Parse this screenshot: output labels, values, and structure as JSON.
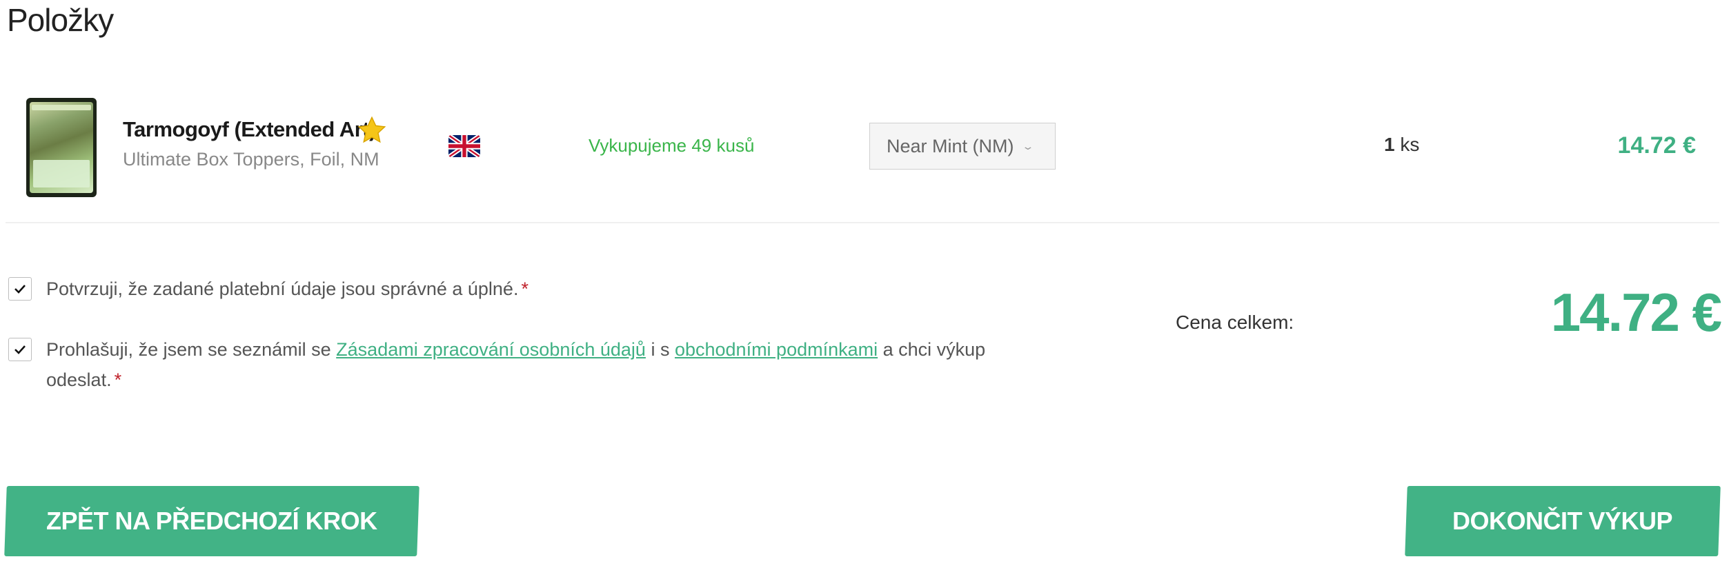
{
  "page": {
    "title": "Položky"
  },
  "item": {
    "name": "Tarmogoyf (Extended Art)",
    "subtitle": "Ultimate Box Toppers, Foil, NM",
    "language_flag": "uk-flag-icon",
    "buy_note": "Vykupujeme 49 kusů",
    "condition": "Near Mint (NM)",
    "quantity": "1",
    "quantity_unit": "ks",
    "price": "14.72 €",
    "featured_icon": "star-icon"
  },
  "confirmations": {
    "payment": {
      "text": "Potvrzuji, že zadané platební údaje jsou správné a úplné.",
      "required_mark": "*",
      "checked": true
    },
    "terms": {
      "text_before": "Prohlašuji, že jsem se seznámil se ",
      "link1": "Zásadami zpracování osobních údajů",
      "text_middle": " i s ",
      "link2": "obchodními podmínkami",
      "text_after": " a chci výkup odeslat.",
      "required_mark": "*",
      "checked": true
    }
  },
  "total": {
    "label": "Cena celkem:",
    "value": "14.72 €"
  },
  "buttons": {
    "back": "ZPĚT NA PŘEDCHOZÍ KROK",
    "finish": "DOKONČIT VÝKUP"
  },
  "colors": {
    "accent": "#42b386",
    "price": "#3fb083",
    "buy_note": "#3ab54a",
    "required": "#c0222b"
  }
}
